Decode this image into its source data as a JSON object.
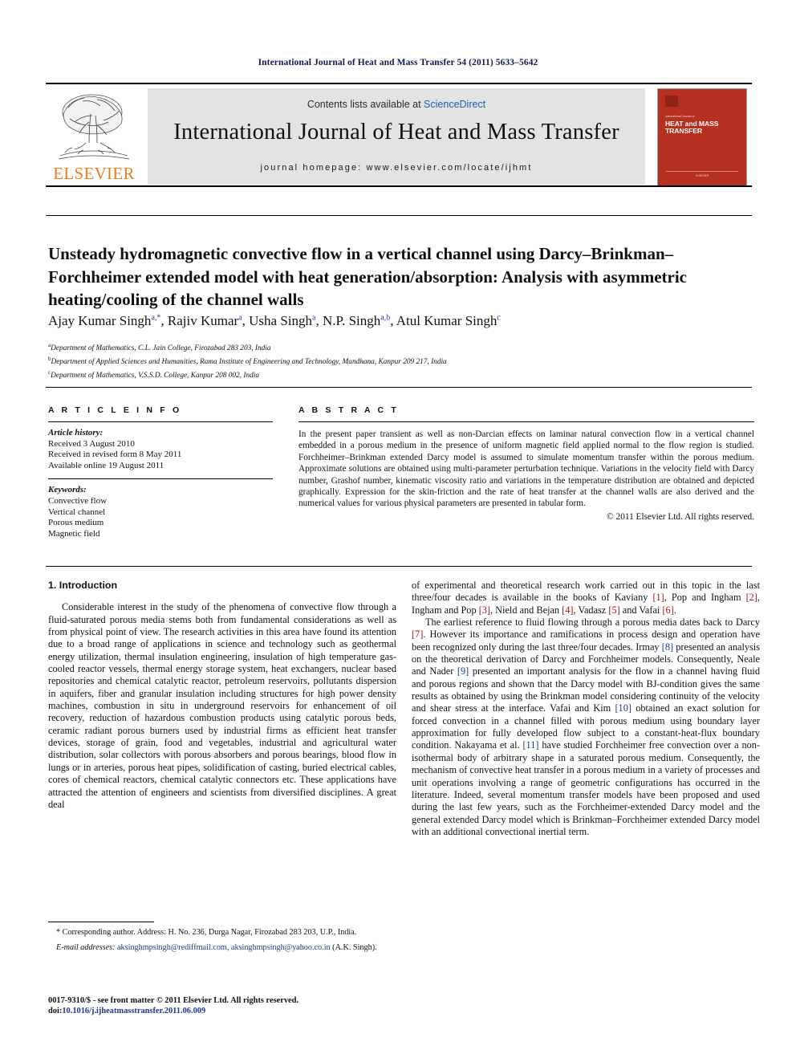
{
  "running_head": "International Journal of Heat and Mass Transfer 54 (2011) 5633–5642",
  "masthead": {
    "contents_prefix": "Contents lists available at ",
    "sciencedirect": "ScienceDirect",
    "journal_title": "International Journal of Heat and Mass Transfer",
    "homepage": "journal homepage: www.elsevier.com/locate/ijhmt",
    "publisher": "ELSEVIER",
    "cover": {
      "small_line": "International Journal of",
      "title_line1": "HEAT and MASS",
      "title_line2": "TRANSFER",
      "footer": "ELSEVIER"
    }
  },
  "article": {
    "title": "Unsteady hydromagnetic convective flow in a vertical channel using Darcy–Brinkman–Forchheimer extended model with heat generation/absorption: Analysis with asymmetric heating/cooling of the channel walls",
    "authors": [
      {
        "name": "Ajay Kumar Singh",
        "marks": "a,*"
      },
      {
        "name": "Rajiv Kumar",
        "marks": "a"
      },
      {
        "name": "Usha Singh",
        "marks": "a"
      },
      {
        "name": "N.P. Singh",
        "marks": "a,b"
      },
      {
        "name": "Atul Kumar Singh",
        "marks": "c"
      }
    ],
    "affiliations": [
      {
        "mark": "a",
        "text": "Department of Mathematics, C.L. Jain College, Firozabad 283 203, India"
      },
      {
        "mark": "b",
        "text": "Department of Applied Sciences and Humanities, Rama Institute of Engineering and Technology, Mandhana, Kanpur 209 217, India"
      },
      {
        "mark": "c",
        "text": "Department of Mathematics, V.S.S.D. College, Kanpur 208 002, India"
      }
    ]
  },
  "info": {
    "heading": "A R T I C L E   I N F O",
    "history_label": "Article history:",
    "history": [
      "Received 3 August 2010",
      "Received in revised form 8 May 2011",
      "Available online 19 August 2011"
    ],
    "keywords_label": "Keywords:",
    "keywords": [
      "Convective flow",
      "Vertical channel",
      "Porous medium",
      "Magnetic field"
    ]
  },
  "abstract": {
    "heading": "A B S T R A C T",
    "text": "In the present paper transient as well as non-Darcian effects on laminar natural convection flow in a vertical channel embedded in a porous medium in the presence of uniform magnetic field applied normal to the flow region is studied. Forchheimer–Brinkman extended Darcy model is assumed to simulate momentum transfer within the porous medium. Approximate solutions are obtained using multi-parameter perturbation technique. Variations in the velocity field with Darcy number, Grashof number, kinematic viscosity ratio and variations in the temperature distribution are obtained and depicted graphically. Expression for the skin-friction and the rate of heat transfer at the channel walls are also derived and the numerical values for various physical parameters are presented in tabular form.",
    "copyright": "© 2011 Elsevier Ltd. All rights reserved."
  },
  "body": {
    "section_number_title": "1. Introduction",
    "left_paragraph_1": "Considerable interest in the study of the phenomena of convective flow through a fluid-saturated porous media stems both from fundamental considerations as well as from physical point of view. The research activities in this area have found its attention due to a broad range of applications in science and technology such as geothermal energy utilization, thermal insulation engineering, insulation of high temperature gas-cooled reactor vessels, thermal energy storage system, heat exchangers, nuclear based repositories and chemical catalytic reactor, petroleum reservoirs, pollutants dispersion in aquifers, fiber and granular insulation including structures for high power density machines, combustion in situ in underground reservoirs for enhancement of oil recovery, reduction of hazardous combustion products using catalytic porous beds, ceramic radiant porous burners used by industrial firms as efficient heat transfer devices, storage of grain, food and vegetables, industrial and agricultural water distribution, solar collectors with porous absorbers and porous bearings, blood flow in lungs or in arteries, porous heat pipes, solidification of casting, buried electrical cables, cores of chemical reactors, chemical catalytic connectors etc. These applications have attracted the attention of engineers and scientists from diversified disciplines. A great deal",
    "right_paragraph_1_continued": "of experimental and theoretical research work carried out in this topic in the last three/four decades is available in the books of Kaviany [1], Pop and Ingham [2], Ingham and Pop [3], Nield and Bejan [4], Vadasz [5] and Vafai [6].",
    "right_paragraph_2": "The earliest reference to fluid flowing through a porous media dates back to Darcy [7]. However its importance and ramifications in process design and operation have been recognized only during the last three/four decades. Irmay [8] presented an analysis on the theoretical derivation of Darcy and Forchheimer models. Consequently, Neale and Nader [9] presented an important analysis for the flow in a channel having fluid and porous regions and shown that the Darcy model with BJ-condition gives the same results as obtained by using the Brinkman model considering continuity of the velocity and shear stress at the interface. Vafai and Kim [10] obtained an exact solution for forced convection in a channel filled with porous medium using boundary layer approximation for fully developed flow subject to a constant-heat-flux boundary condition. Nakayama et al. [11] have studied Forchheimer free convection over a non-isothermal body of arbitrary shape in a saturated porous medium. Consequently, the mechanism of convective heat transfer in a porous medium in a variety of processes and unit operations involving a range of geometric configurations has occurred in the literature. Indeed, several momentum transfer models have been proposed and used during the last few years, such as the Forchheimer-extended Darcy model and the general extended Darcy model which is Brinkman–Forchheimer extended Darcy model with an additional convectional inertial term."
  },
  "footnote": {
    "corresponding": "* Corresponding author. Address: H. No. 236, Durga Nagar, Firozabad 283 203, U.P., India.",
    "email_label": "E-mail addresses:",
    "emails": "aksinghmpsingh@rediffmail.com, aksinghmpsingh@yahoo.co.in",
    "email_owner": "(A.K. Singh)."
  },
  "imprint": {
    "line1": "0017-9310/$ - see front matter © 2011 Elsevier Ltd. All rights reserved.",
    "doi_label": "doi:",
    "doi": "10.1016/j.ijheatmasstransfer.2011.06.009"
  },
  "colors": {
    "running_head": "#12194f",
    "sciencedirect": "#1b5eb5",
    "elsevier_orange": "#f07c1f",
    "cover_red": "#b5301f",
    "citation_red": "#a11818",
    "link_blue": "#1b3a8c"
  }
}
